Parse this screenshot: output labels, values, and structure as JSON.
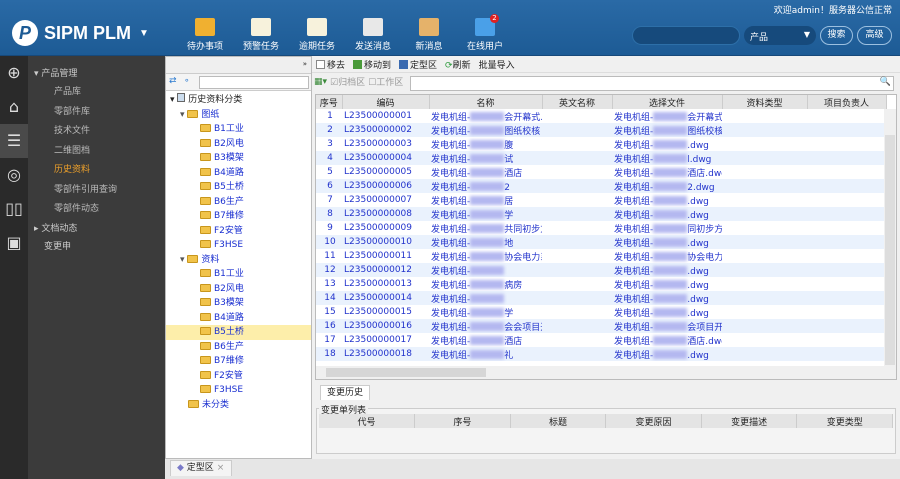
{
  "header": {
    "welcome": "欢迎admin！服务器公信正常",
    "logo": "SIPM PLM",
    "tools": [
      {
        "label": "待办事项",
        "icon": "todo-icon",
        "color": "#f0b030"
      },
      {
        "label": "预警任务",
        "icon": "warning-task-icon",
        "color": "#f7f2dc"
      },
      {
        "label": "逾期任务",
        "icon": "overdue-task-icon",
        "color": "#f7f2dc"
      },
      {
        "label": "发送消息",
        "icon": "send-message-icon",
        "color": "#e8e8e8"
      },
      {
        "label": "新消息",
        "icon": "new-message-icon",
        "color": "#e5b26a"
      },
      {
        "label": "在线用户",
        "icon": "online-users-icon",
        "color": "#4aa0e8",
        "badge": "2"
      }
    ],
    "search_placeholder": "",
    "select_value": "产品",
    "search_btn": "搜索",
    "advanced_btn": "高级"
  },
  "nav": {
    "group1": "产品管理",
    "items": [
      "产品库",
      "零部件库",
      "技术文件",
      "二维图档",
      "历史资料",
      "零部件引用查询",
      "零部件动态"
    ],
    "selected": "历史资料",
    "group2": "文档动态",
    "item_change": "变更申"
  },
  "tree": {
    "root": "历史资料分类",
    "groups": [
      {
        "label": "图纸",
        "children": [
          "B1工业",
          "B2风电",
          "B3模架",
          "B4道路",
          "B5土桥",
          "B6生产",
          "B7维修",
          "F2安管",
          "F3HSE"
        ]
      },
      {
        "label": "资料",
        "children": [
          "B1工业",
          "B2风电",
          "B3模架",
          "B4道路",
          "B5土桥",
          "B6生产",
          "B7维修",
          "F2安管",
          "F3HSE"
        ]
      }
    ],
    "other": "未分类",
    "selected": "B5土桥",
    "bottom_tab": "定型区"
  },
  "toolbar": {
    "remove": "移去",
    "move_to": "移动到",
    "finalize": "定型区",
    "refresh": "刷新",
    "batch_import": "批量导入",
    "archive": "归档区",
    "work": "工作区"
  },
  "table": {
    "columns": [
      "序号",
      "编码",
      "名称",
      "英文名称",
      "选择文件",
      "资料类型",
      "项目负责人"
    ],
    "rows": [
      {
        "no": "1",
        "code": "L23500000001",
        "name": "发电机组-",
        "name_s": "会开幕式...",
        "file": "发电机组-",
        "file_s": "会开幕式..."
      },
      {
        "no": "2",
        "code": "L23500000002",
        "name": "发电机组-",
        "name_s": "图纸校核",
        "file": "发电机组-",
        "file_s": "图纸校核.d..."
      },
      {
        "no": "3",
        "code": "L23500000003",
        "name": "发电机组-",
        "name_s": "腹",
        "file": "发电机组-",
        "file_s": ".dwg"
      },
      {
        "no": "4",
        "code": "L23500000004",
        "name": "发电机组-",
        "name_s": "试",
        "file": "发电机组-",
        "file_s": "l.dwg"
      },
      {
        "no": "5",
        "code": "L23500000005",
        "name": "发电机组-",
        "name_s": "酒店",
        "file": "发电机组-",
        "file_s": "酒店.dwg"
      },
      {
        "no": "6",
        "code": "L23500000006",
        "name": "发电机组-",
        "name_s": "2",
        "file": "发电机组-",
        "file_s": "2.dwg"
      },
      {
        "no": "7",
        "code": "L23500000007",
        "name": "发电机组-",
        "name_s": "居",
        "file": "发电机组-",
        "file_s": ".dwg"
      },
      {
        "no": "8",
        "code": "L23500000008",
        "name": "发电机组-",
        "name_s": "学",
        "file": "发电机组-",
        "file_s": ".dwg"
      },
      {
        "no": "9",
        "code": "L23500000009",
        "name": "发电机组-",
        "name_s": "共同初步方...",
        "file": "发电机组-",
        "file_s": "同初步方..."
      },
      {
        "no": "10",
        "code": "L23500000010",
        "name": "发电机组-",
        "name_s": "地",
        "file": "发电机组-",
        "file_s": ".dwg"
      },
      {
        "no": "11",
        "code": "L23500000011",
        "name": "发电机组-",
        "name_s": "协会电力系...",
        "file": "发电机组-",
        "file_s": "协会电力系..."
      },
      {
        "no": "12",
        "code": "L23500000012",
        "name": "发电机组-",
        "name_s": "",
        "file": "发电机组-",
        "file_s": ".dwg"
      },
      {
        "no": "13",
        "code": "L23500000013",
        "name": "发电机组-",
        "name_s": "病房",
        "file": "发电机组-",
        "file_s": ".dwg"
      },
      {
        "no": "14",
        "code": "L23500000014",
        "name": "发电机组-",
        "name_s": "",
        "file": "发电机组-",
        "file_s": ".dwg"
      },
      {
        "no": "15",
        "code": "L23500000015",
        "name": "发电机组-",
        "name_s": "学",
        "file": "发电机组-",
        "file_s": ".dwg"
      },
      {
        "no": "16",
        "code": "L23500000016",
        "name": "发电机组-",
        "name_s": "会会项目开...",
        "file": "发电机组-",
        "file_s": "会项目开..."
      },
      {
        "no": "17",
        "code": "L23500000017",
        "name": "发电机组-",
        "name_s": "酒店",
        "file": "发电机组-",
        "file_s": "酒店.dwg"
      },
      {
        "no": "18",
        "code": "L23500000018",
        "name": "发电机组-",
        "name_s": "礼",
        "file": "发电机组-",
        "file_s": ".dwg"
      }
    ]
  },
  "history": {
    "tab": "变更历史",
    "legend": "变更单列表",
    "columns": [
      "代号",
      "序号",
      "标题",
      "变更原因",
      "变更描述",
      "变更类型"
    ]
  }
}
